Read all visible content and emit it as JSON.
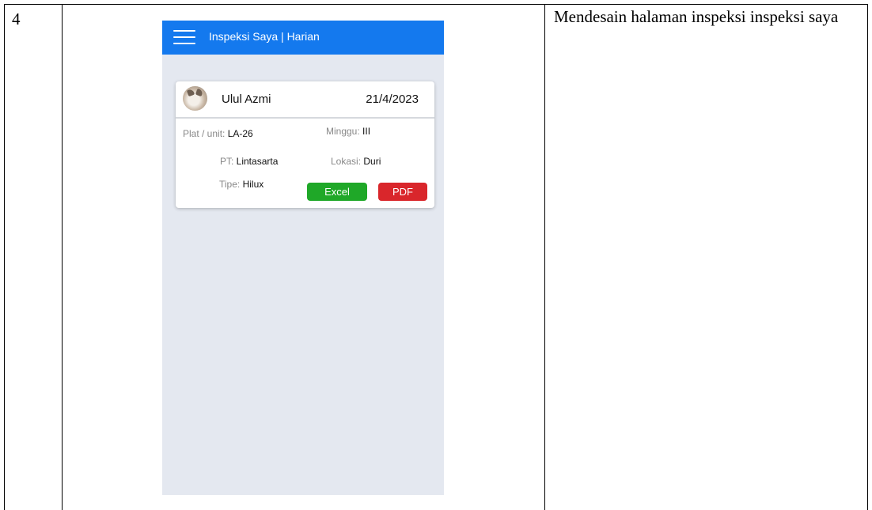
{
  "document": {
    "row_number": "4",
    "description": "Mendesain halaman inspeksi inspeksi saya"
  },
  "app": {
    "header_title": "Inspeksi Saya | Harian",
    "header_color": "#1479ee",
    "background_color": "#e4e8f0"
  },
  "card": {
    "name": "Ulul Azmi",
    "date": "21/4/2023",
    "fields": {
      "plat": {
        "label": "Plat / unit: ",
        "value": "LA-26"
      },
      "minggu": {
        "label": "Minggu: ",
        "value": "III"
      },
      "pt": {
        "label": "PT: ",
        "value": "Lintasarta"
      },
      "lokasi": {
        "label": "Lokasi: ",
        "value": "Duri"
      },
      "tipe": {
        "label": "Tipe: ",
        "value": "Hilux"
      }
    },
    "buttons": {
      "excel": {
        "label": "Excel",
        "color": "#1fa828"
      },
      "pdf": {
        "label": "PDF",
        "color": "#d9262b"
      }
    }
  }
}
